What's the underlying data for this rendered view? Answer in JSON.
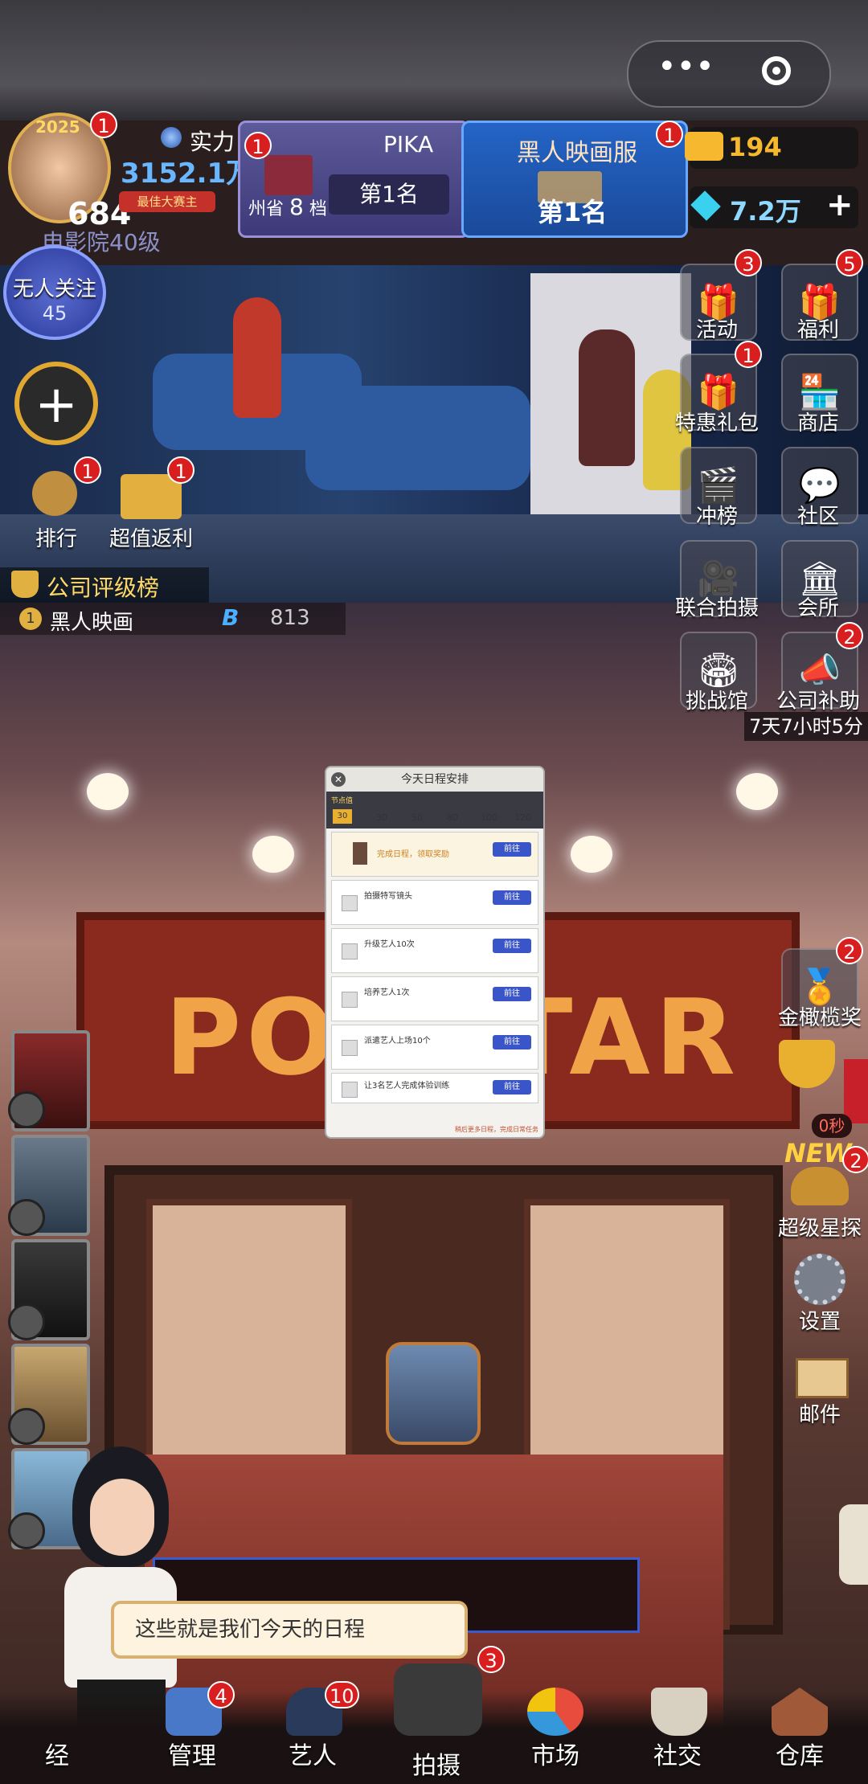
{
  "top_bar": {
    "more_icon": "•••",
    "close_icon": "target-circle"
  },
  "profile": {
    "year_badge": "2025",
    "strength_label": "实力",
    "power_value": "3152.1万",
    "level": "684",
    "rank_ribbon": "最佳大赛主",
    "cinema_level": "电影院40级",
    "avatar_badge": "1"
  },
  "pika_panel": {
    "name": "PIKA",
    "region": "州省",
    "tier_num": "8",
    "tier_unit": "档",
    "rank": "第1名",
    "badge": "1"
  },
  "company_panel": {
    "name": "黑人映画服",
    "rank": "第1名",
    "badge": "1"
  },
  "currency": {
    "gold": "194",
    "gems": "7.2万",
    "plus": "+"
  },
  "followers": {
    "label": "无人关注",
    "count": "45"
  },
  "add_button": "+",
  "left_actions": [
    {
      "label": "排行",
      "badge": "1"
    },
    {
      "label": "超值返利",
      "badge": "1"
    }
  ],
  "rating": {
    "label": "公司评级榜",
    "company": "黑人映画",
    "rank": "1",
    "grade": "B",
    "score": "813"
  },
  "side_menu": [
    {
      "label": "活动",
      "badge": "3"
    },
    {
      "label": "福利",
      "badge": "5"
    },
    {
      "label": "特惠礼包",
      "badge": "1"
    },
    {
      "label": "商店",
      "badge": ""
    },
    {
      "label": "冲榜",
      "badge": ""
    },
    {
      "label": "社区",
      "badge": ""
    },
    {
      "label": "联合拍摄",
      "badge": ""
    },
    {
      "label": "会所",
      "badge": ""
    },
    {
      "label": "挑战馆",
      "badge": ""
    },
    {
      "label": "公司补助",
      "badge": "2"
    }
  ],
  "subsidy_timer": "7天7小时5分",
  "side_menu_lower": [
    {
      "label": "金橄榄奖",
      "badge": "2"
    },
    {
      "label": "超级星探",
      "badge": "2"
    },
    {
      "label": "设置",
      "badge": ""
    },
    {
      "label": "邮件",
      "badge": ""
    }
  ],
  "trophy_timer": "0秒",
  "new_tag": "NEW",
  "sign_text": "POPSTAR",
  "dialog": {
    "title": "今天日程安排",
    "progress_label": "节点值",
    "progress_current": "30",
    "milestones": [
      "30",
      "50",
      "80",
      "100",
      "120"
    ],
    "tasks": [
      {
        "text": "完成日程，领取奖励",
        "button": "前往"
      },
      {
        "text": "拍摄特写镜头",
        "button": "前往"
      },
      {
        "text": "升级艺人10次",
        "button": "前往"
      },
      {
        "text": "培养艺人1次",
        "button": "前往"
      },
      {
        "text": "派遣艺人上场10个",
        "button": "前往"
      },
      {
        "text": "让3名艺人完成体验训练",
        "button": "前往"
      }
    ],
    "footer": "稍后更多日程，完成日常任务"
  },
  "speech": "这些就是我们今天的日程",
  "bottom_nav": [
    {
      "label": "经",
      "badge": ""
    },
    {
      "label": "管理",
      "badge": "4"
    },
    {
      "label": "艺人",
      "badge": "10"
    },
    {
      "label": "拍摄",
      "badge": "3"
    },
    {
      "label": "市场",
      "badge": ""
    },
    {
      "label": "社交",
      "badge": ""
    },
    {
      "label": "仓库",
      "badge": ""
    }
  ],
  "colors": {
    "accent_blue": "#2464c6",
    "badge_red": "#d81e1e",
    "gold": "#f5b82e"
  }
}
